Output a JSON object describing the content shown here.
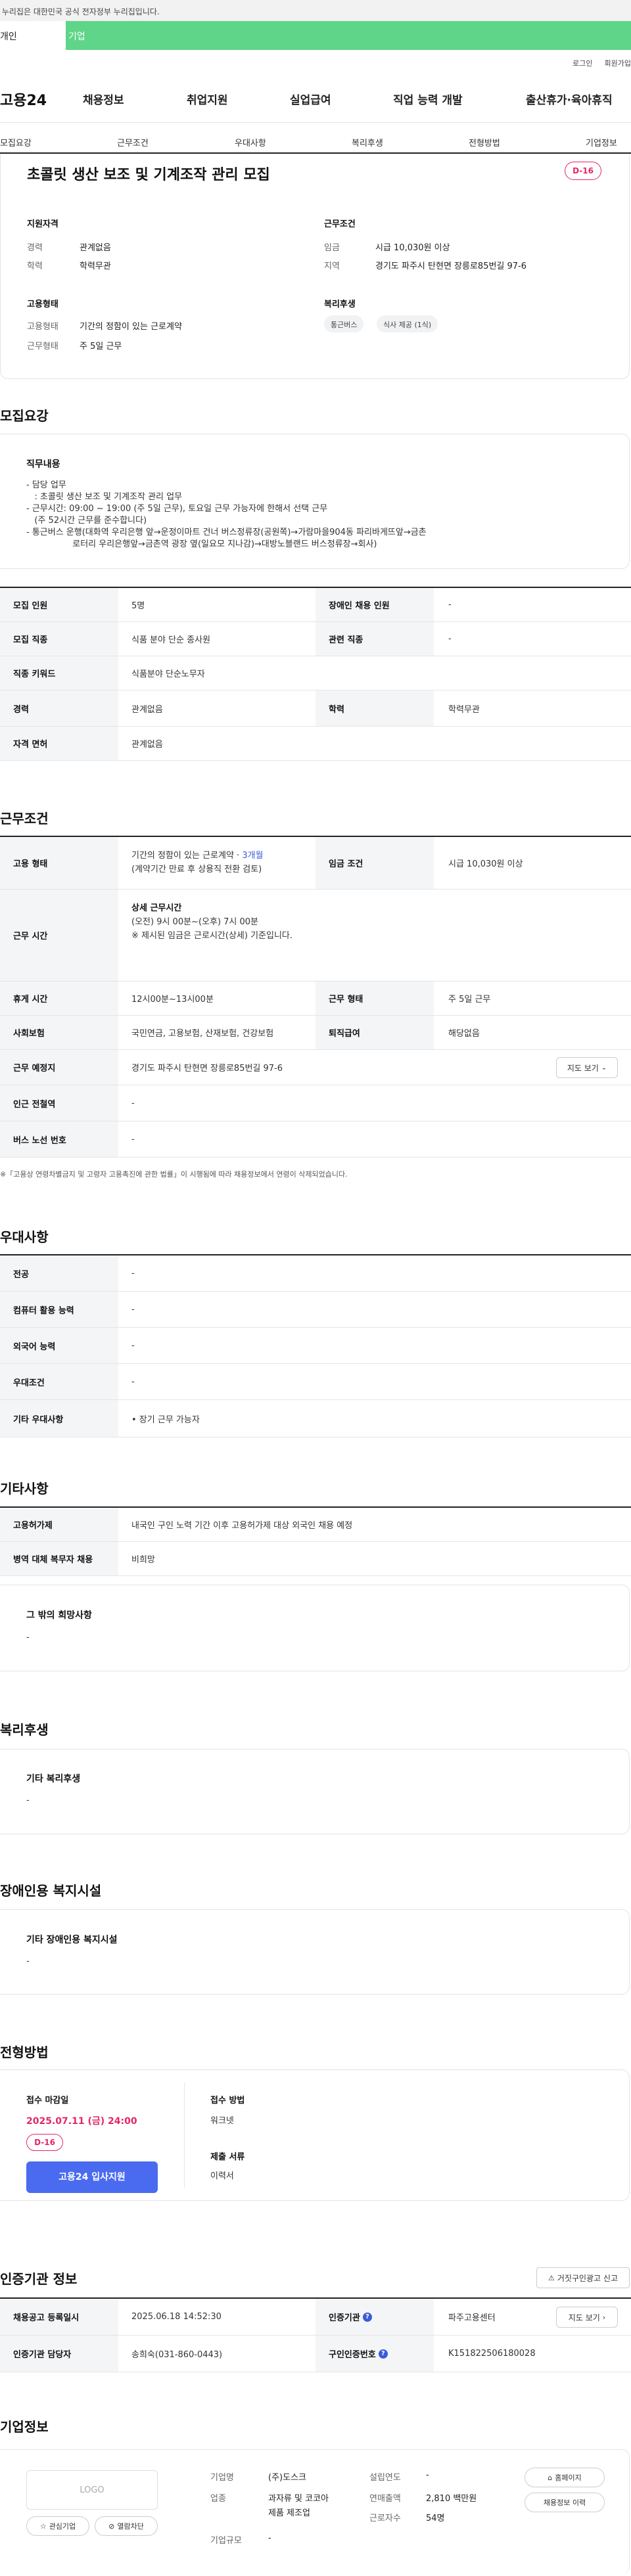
{
  "gov_banner": "이 누리집은 대한민국 공식 전자정부 누리집입니다.",
  "user_tabs": {
    "individual": "개인",
    "business": "기업"
  },
  "top_links": {
    "login": "로그인",
    "signup": "회원가입"
  },
  "gnb": {
    "logo": "고용24",
    "items": [
      "채용정보",
      "취업지원",
      "실업급여",
      "직업 능력 개발",
      "출산휴가·육아휴직"
    ]
  },
  "anchors": [
    "모집요강",
    "근무조건",
    "우대사항",
    "복리후생",
    "전형방법",
    "기업정보"
  ],
  "summary": {
    "title": "초콜릿 생산 보조 및 기계조작 관리 모집",
    "dday": "D-16",
    "qual_heading": "지원자격",
    "career_label": "경력",
    "career_value": "관계없음",
    "edu_label": "학력",
    "edu_value": "학력무관",
    "cond_heading": "근무조건",
    "wage_label": "임금",
    "wage_value": "시급 10,030원 이상",
    "region_label": "지역",
    "region_value": "경기도 파주시 탄현면 장릉로85번길 97-6",
    "emp_heading": "고용형태",
    "emp_type_label": "고용형태",
    "emp_type_value": "기간의 정함이 있는 근로계약",
    "work_type_label": "근무형태",
    "work_type_value": "주 5일 근무",
    "welfare_heading": "복리후생",
    "welfare_chips": [
      "통근버스",
      "식사 제공 (1식)"
    ]
  },
  "recruit": {
    "section_title": "모집요강",
    "duty_heading": "직무내용",
    "duty_lines": [
      "- 담당 업무",
      "   : 초콜릿 생산 보조 및 기계조작 관리 업무",
      "- 근무시간: 09:00 ~ 19:00 (주 5일 근무), 토요일 근무 가능자에 한해서 선택 근무",
      "   (주 52시간 근무를 준수합니다)",
      "- 통근버스 운행(대화역 우리은행 앞→운정이마트 건너 버스정류장(공원쪽)→가람마을904동 파리바게뜨앞→금촌",
      "                 로터리 우리은행앞→금촌역 광장 옆(일요모 지나감)→대방노블랜드 버스정류장→회사)"
    ],
    "rows": {
      "headcount_label": "모집 인원",
      "headcount_value": "5명",
      "disabled_label": "장애인 채용 인원",
      "disabled_value": "-",
      "job_label": "모집 직종",
      "job_value": "식품 분야 단순 종사원",
      "related_label": "관련 직종",
      "related_value": "-",
      "keyword_label": "직종 키워드",
      "keyword_value": "식품분야 단순노무자",
      "career_label": "경력",
      "career_value": "관계없음",
      "edu_label": "학력",
      "edu_value": "학력무관",
      "license_label": "자격 면허",
      "license_value": "관계없음"
    }
  },
  "conditions": {
    "section_title": "근무조건",
    "emp_label": "고용 형태",
    "emp_value_1": "기간의 정함이 있는 근로계약 · ",
    "emp_value_months": "3개월",
    "emp_value_2": "(계약기간 만료 후 상용직 전환 검토)",
    "wage_label": "임금 조건",
    "wage_value": "시급 10,030원 이상",
    "hours_label": "근무 시간",
    "hours_heading": "상세 근무시간",
    "hours_line1": "(오전) 9시 00분~(오후) 7시 00분",
    "hours_line2": "※ 제시된 임금은 근로시간(상세) 기준입니다.",
    "break_label": "휴게 시간",
    "break_value": "12시00분~13시00분",
    "worktype_label": "근무 형태",
    "worktype_value": "주 5일 근무",
    "insurance_label": "사회보험",
    "insurance_value": "국민연금, 고용보험, 산재보험, 건강보험",
    "severance_label": "퇴직급여",
    "severance_value": "해당없음",
    "place_label": "근무 예정지",
    "place_value": "경기도 파주시 탄현면 장릉로85번길 97-6",
    "map_button": "지도 보기",
    "station_label": "인근 전철역",
    "station_value": "-",
    "bus_label": "버스 노선 번호",
    "bus_value": "-",
    "note": "※「고용상 연령차별금지 및 고령자 고용촉진에 관한 법률」이 시행됨에 따라 채용정보에서 연령이 삭제되었습니다."
  },
  "preference": {
    "section_title": "우대사항",
    "major_label": "전공",
    "major_value": "-",
    "computer_label": "컴퓨터 활용 능력",
    "computer_value": "-",
    "language_label": "외국어 능력",
    "language_value": "-",
    "cond_label": "우대조건",
    "cond_value": "-",
    "other_label": "기타 우대사항",
    "other_value": "• 장기 근무 가능자"
  },
  "other": {
    "section_title": "기타사항",
    "permit_label": "고용허가제",
    "permit_value": "내국인 구인 노력 기간 이후 고용허가제 대상 외국인 채용 예정",
    "military_label": "병역 대체 복무자 채용",
    "military_value": "비희망",
    "extra_heading": "그 밖의 희망사항",
    "extra_value": "-"
  },
  "welfare": {
    "section_title": "복리후생",
    "heading": "기타 복리후생",
    "value": "-"
  },
  "disabled_welfare": {
    "section_title": "장애인용 복지시설",
    "heading": "기타 장애인용 복지시설",
    "value": "-"
  },
  "selection": {
    "section_title": "전형방법",
    "deadline_heading": "접수 마감일",
    "deadline_value": "2025.07.11 (금) 24:00",
    "dday": "D-16",
    "apply_button": "고용24 입사지원",
    "method_heading": "접수 방법",
    "method_value": "워크넷",
    "docs_heading": "제출 서류",
    "docs_value": "이력서"
  },
  "agency": {
    "section_title": "인증기관 정보",
    "report_button": "거짓구인광고 신고",
    "reg_date_label": "채용공고 등록일시",
    "reg_date_value": "2025.06.18 14:52:30",
    "agency_label": "인증기관",
    "agency_value": "파주고용센터",
    "map_button": "지도 보기",
    "manager_label": "인증기관 담당자",
    "manager_value": "송희숙(031-860-0443)",
    "auth_no_label": "구인인증번호",
    "auth_no_value": "K151822506180028"
  },
  "company": {
    "section_title": "기업정보",
    "logo_text": "LOGO",
    "interest_button": "관심기업",
    "block_button": "열람차단",
    "name_label": "기업명",
    "name_value": "(주)도스크",
    "industry_label": "업종",
    "industry_value_1": "과자류 및 코코아",
    "industry_value_2": "제품 제조업",
    "size_label": "기업규모",
    "size_value": "-",
    "founded_label": "설립연도",
    "founded_value": "-",
    "sales_label": "연매출액",
    "sales_value": "2,810 백만원",
    "employees_label": "근로자수",
    "employees_value": "54명",
    "homepage_button": "홈페이지",
    "history_button": "채용정보 이력"
  },
  "colors": {
    "accent": "#4a6bf0",
    "brand_green": "#5fd589",
    "dday": "#e5266a"
  }
}
